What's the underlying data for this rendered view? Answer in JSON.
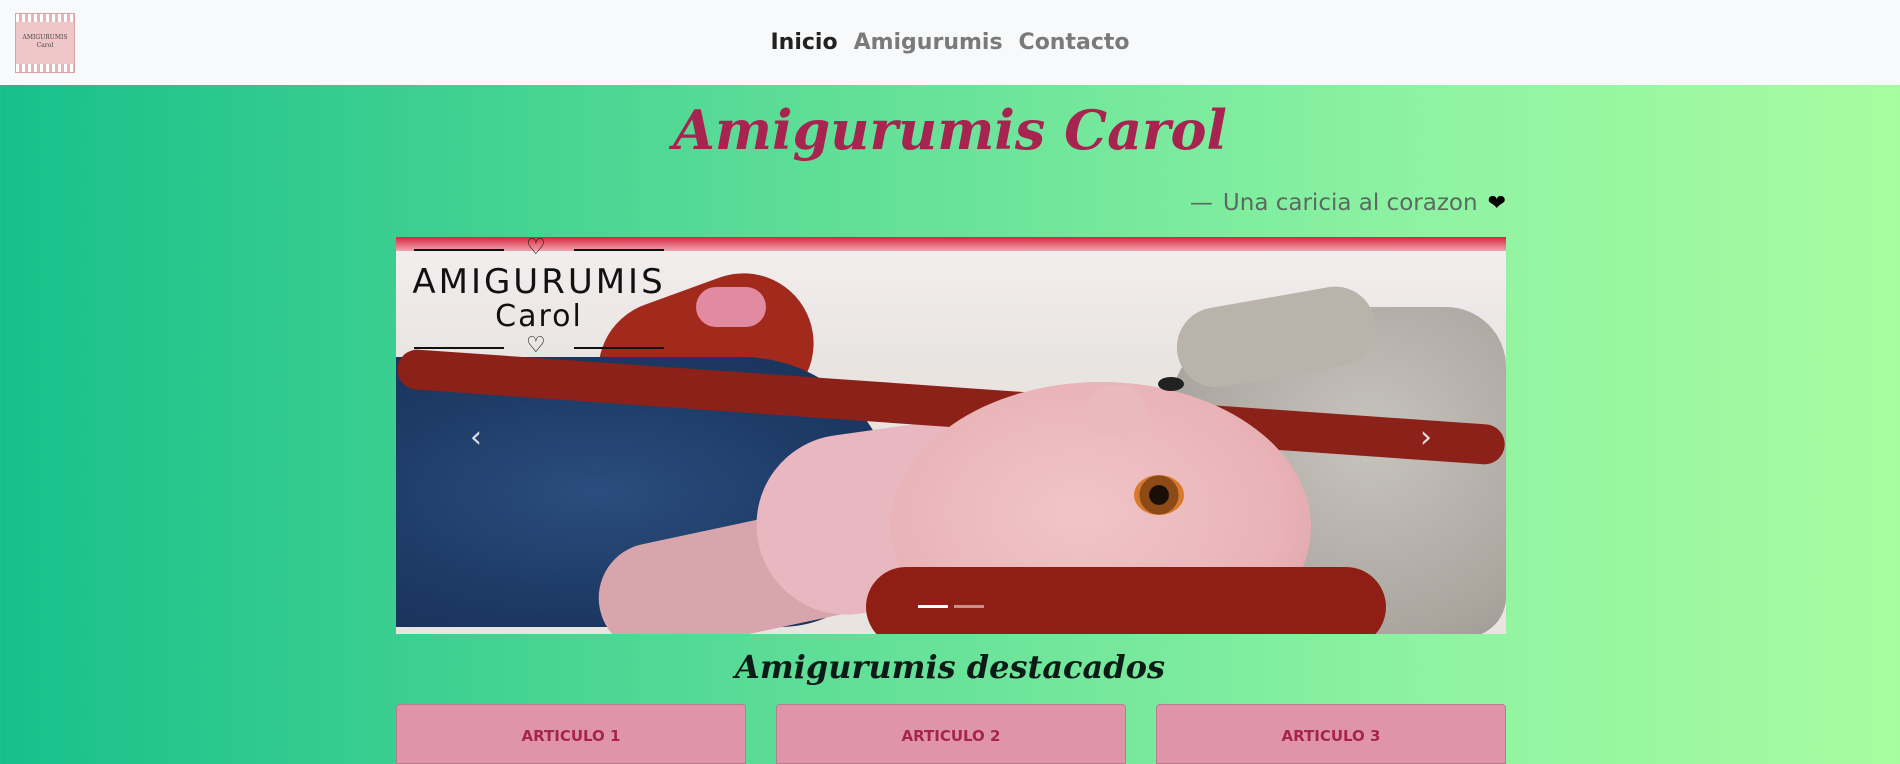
{
  "navbar": {
    "logo_text_line1": "AMIGURUMIS",
    "logo_text_line2": "Carol",
    "links": [
      {
        "label": "Inicio",
        "active": true
      },
      {
        "label": "Amigurumis",
        "active": false
      },
      {
        "label": "Contacto",
        "active": false
      }
    ]
  },
  "hero": {
    "title": "Amigurumis Carol",
    "tagline_dash": "—",
    "tagline": "Una caricia al corazon",
    "tagline_icon": "heart-icon"
  },
  "carousel": {
    "overlay_brand_line1": "AMIGURUMIS",
    "overlay_brand_line2": "Carol",
    "prev_icon": "chevron-left-icon",
    "next_icon": "chevron-right-icon",
    "slides": 2,
    "active_slide": 1
  },
  "featured": {
    "title": "Amigurumis destacados",
    "cards": [
      {
        "title": "ARTICULO 1"
      },
      {
        "title": "ARTICULO 2"
      },
      {
        "title": "ARTICULO 3"
      }
    ]
  },
  "colors": {
    "title": "#a72450",
    "card": "#df94a9",
    "gradient_start": "#17c08a",
    "gradient_end": "#a8fca0"
  }
}
